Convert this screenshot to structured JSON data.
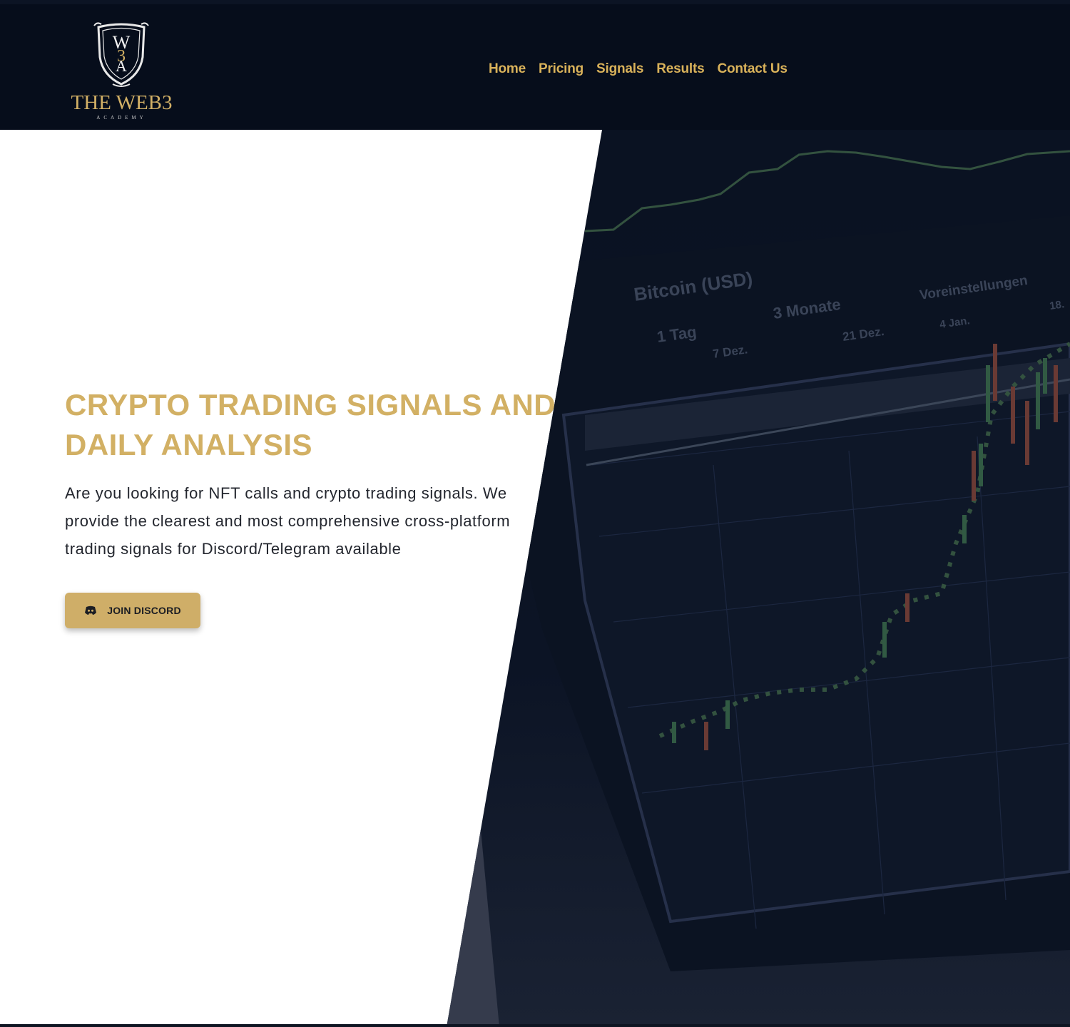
{
  "brand": {
    "name": "THE WEB3",
    "subtitle": "ACADEMY",
    "monogram": "W3A",
    "gold": "#d2b064",
    "navy": "#060d1b"
  },
  "nav": {
    "items": [
      {
        "label": "Home"
      },
      {
        "label": "Pricing"
      },
      {
        "label": "Signals"
      },
      {
        "label": "Results"
      },
      {
        "label": "Contact Us"
      }
    ]
  },
  "hero": {
    "title_line1": "CRYPTO TRADING SIGNALS AND",
    "title_line2": "DAILY ANALYSIS",
    "description": "Are you looking for NFT calls and crypto trading signals. We provide the clearest and most comprehensive cross-platform trading signals for Discord/Telegram available",
    "cta_label": "JOIN DISCORD",
    "cta_icon": "discord-icon"
  },
  "background_chart": {
    "toolbar_title": "Bitcoin (USD)",
    "range_button": "3 Monate",
    "interval_button": "1 Tag",
    "settings_label": "Voreinstellungen",
    "date_labels": [
      "7 Dez.",
      "21 Dez.",
      "4 Jan.",
      "18."
    ]
  }
}
